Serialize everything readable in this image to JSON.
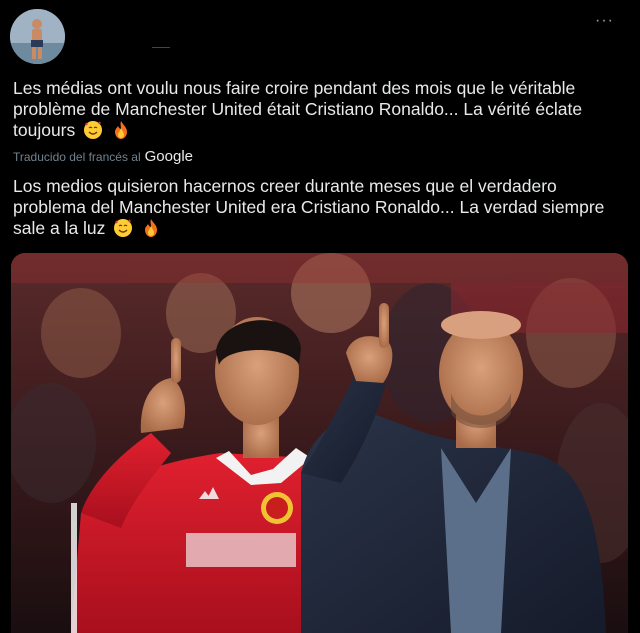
{
  "post": {
    "more_label": "···",
    "original_text": "Les médias ont voulu nous faire croire pendant des mois que le véritable problème de Manchester United était Cristiano Ronaldo... La vérité éclate toujours",
    "translated_by_label": "Traducido del francés al",
    "translator_brand": "Google",
    "translated_text": "Los medios quisieron hacernos creer durante meses que el verdadero problema del Manchester United era Cristiano Ronaldo... La verdad siempre sale a la luz",
    "emojis": [
      "smiling-face-with-hearts-emoji",
      "fire-emoji"
    ]
  },
  "colors": {
    "background": "#000000",
    "text": "#e7e9ea",
    "muted": "#71838f",
    "jersey_red": "#d3162a"
  }
}
